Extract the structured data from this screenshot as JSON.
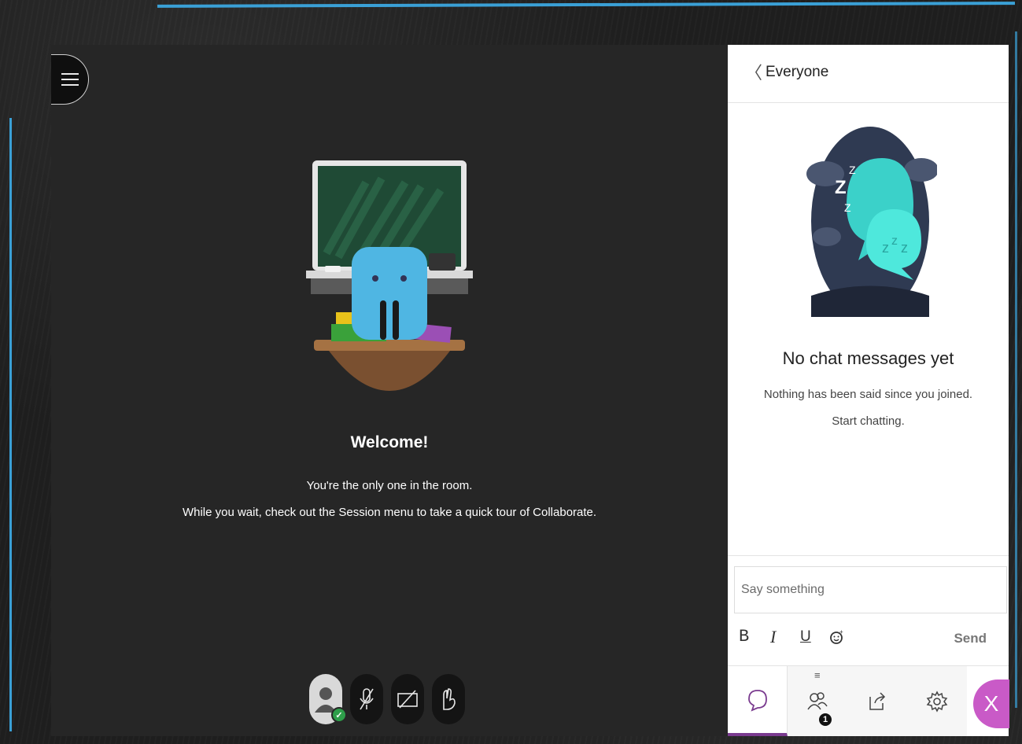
{
  "stage": {
    "menu_icon": "hamburger-icon",
    "welcome_title": "Welcome!",
    "welcome_line1": "You're the only one in the room.",
    "welcome_line2": "While you wait, check out the Session menu to take a quick tour of Collaborate.",
    "controls": [
      {
        "name": "avatar",
        "icon": "user-avatar-icon",
        "status": "check-icon"
      },
      {
        "name": "microphone",
        "icon": "microphone-off-icon"
      },
      {
        "name": "camera",
        "icon": "camera-off-icon"
      },
      {
        "name": "raise-hand",
        "icon": "hand-icon"
      }
    ]
  },
  "chat": {
    "back_glyph": "〈",
    "title": "Everyone",
    "empty_title": "No chat messages yet",
    "empty_line1": "Nothing has been said since you joined.",
    "empty_line2": "Start chatting.",
    "input_placeholder": "Say something",
    "format": {
      "bold": "B",
      "italic": "I",
      "underline": "U"
    },
    "send_label": "Send",
    "tabs": [
      {
        "name": "chat",
        "icon": "chat-bubble-icon",
        "active": true
      },
      {
        "name": "attendees",
        "icon": "people-icon",
        "badge": "1"
      },
      {
        "name": "share",
        "icon": "share-icon"
      },
      {
        "name": "settings",
        "icon": "gear-icon"
      }
    ],
    "close_glyph": "X"
  },
  "colors": {
    "chalk_blue": "#3aa0d6",
    "stage_bg": "#262626",
    "accent_purple": "#7a3b8f",
    "close_pink": "#c95ac7",
    "status_green": "#2e9e4a"
  }
}
